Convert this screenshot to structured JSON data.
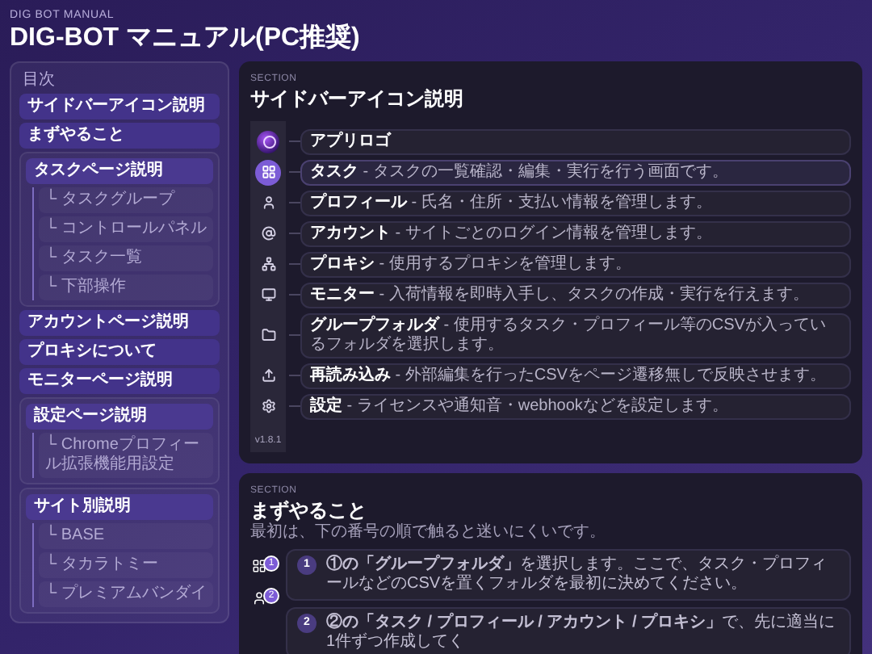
{
  "header": {
    "eyebrow": "DIG BOT MANUAL",
    "title": "DIG-BOT マニュアル(PC推奨)"
  },
  "toc": {
    "label": "目次",
    "items": [
      {
        "label": "サイドバーアイコン説明"
      },
      {
        "label": "まずやること"
      },
      {
        "label": "タスクページ説明",
        "children": [
          {
            "label": "└ タスクグループ"
          },
          {
            "label": "└ コントロールパネル"
          },
          {
            "label": "└ タスク一覧"
          },
          {
            "label": "└ 下部操作"
          }
        ]
      },
      {
        "label": "アカウントページ説明"
      },
      {
        "label": "プロキシについて"
      },
      {
        "label": "モニターページ説明"
      },
      {
        "label": "設定ページ説明",
        "children": [
          {
            "label": "└ Chromeプロフィール拡張機能用設定"
          }
        ]
      },
      {
        "label": "サイト別説明",
        "children": [
          {
            "label": "└ BASE"
          },
          {
            "label": "└ タカラトミー"
          },
          {
            "label": "└ プレミアムバンダイ"
          }
        ]
      }
    ]
  },
  "sections": [
    {
      "eyebrow": "SECTION",
      "title": "サイドバーアイコン説明",
      "version": "v1.8.1",
      "icons": [
        {
          "selected": false,
          "text": "**アプリロゴ**"
        },
        {
          "selected": true,
          "text": "**タスク** - タスクの一覧確認・編集・実行を行う画面です。"
        },
        {
          "selected": false,
          "text": "**プロフィール** - 氏名・住所・支払い情報を管理します。"
        },
        {
          "selected": false,
          "text": "**アカウント** - サイトごとのログイン情報を管理します。"
        },
        {
          "selected": false,
          "text": "**プロキシ** - 使用するプロキシを管理します。"
        },
        {
          "selected": false,
          "text": "**モニター** - 入荷情報を即時入手し、タスクの作成・実行を行えます。"
        },
        {
          "selected": false,
          "text": "**グループフォルダ** - 使用するタスク・プロフィール等のCSVが入っているフォルダを選択します。"
        },
        {
          "selected": false,
          "text": "**再読み込み** - 外部編集を行ったCSVをページ遷移無しで反映させます。"
        },
        {
          "selected": false,
          "text": "**設定** - ライセンスや通知音・webhookなどを設定します。"
        }
      ]
    },
    {
      "eyebrow": "SECTION",
      "title": "まずやること",
      "subtitle": "最初は、下の番号の順で触ると迷いにくいです。",
      "badges": [
        "1",
        "2"
      ],
      "steps": [
        {
          "number": "1",
          "text": "**①の「グループフォルダ」**を選択します。ここで、タスク・プロフィールなどのCSVを置くフォルダを最初に決めてください。"
        },
        {
          "number": "2",
          "text": "**②の「タスク / プロフィール / アカウント / プロキシ」**で、先に適当に1件ずつ作成してく"
        }
      ]
    }
  ]
}
